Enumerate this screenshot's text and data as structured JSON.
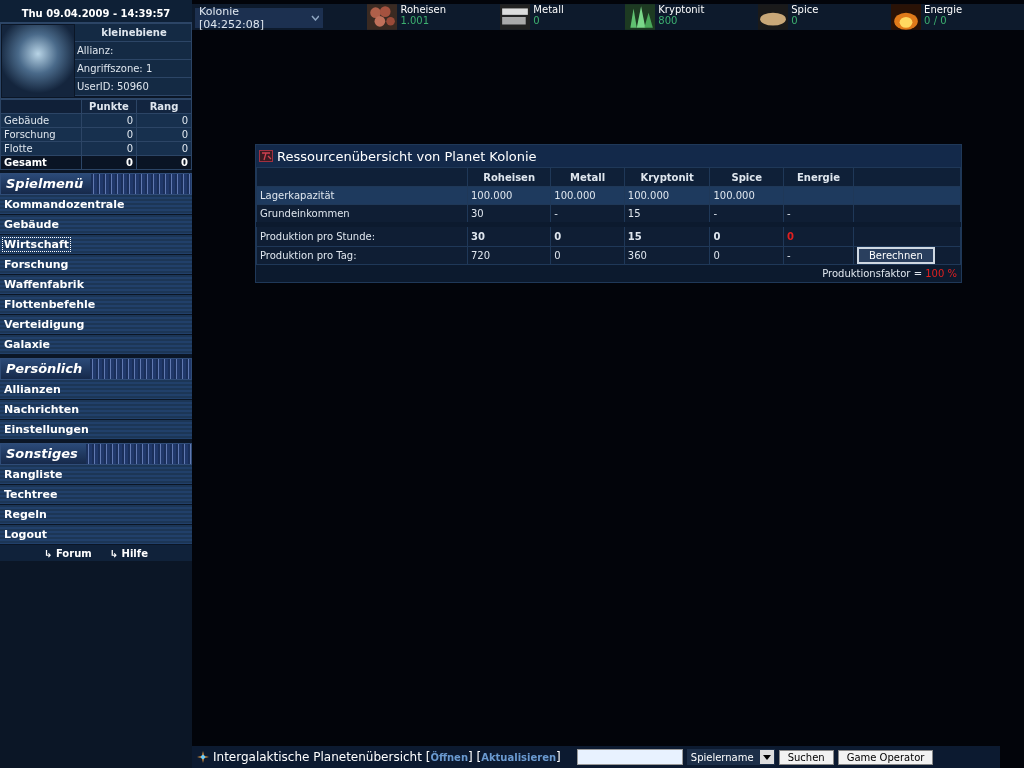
{
  "sidebar": {
    "datetime": "Thu 09.04.2009 - 14:39:57",
    "profile": {
      "username": "kleinebiene",
      "fields": [
        "Allianz:",
        "Angriffszone: 1",
        "UserID: 50960"
      ]
    },
    "stats": {
      "columns": [
        "Punkte",
        "Rang"
      ],
      "rows": [
        {
          "label": "Gebäude",
          "punkte": "0",
          "rang": "0",
          "total": false
        },
        {
          "label": "Forschung",
          "punkte": "0",
          "rang": "0",
          "total": false
        },
        {
          "label": "Flotte",
          "punkte": "0",
          "rang": "0",
          "total": false
        },
        {
          "label": "Gesamt",
          "punkte": "0",
          "rang": "0",
          "total": true
        }
      ]
    },
    "menus": [
      {
        "title": "Spielmenü",
        "items": [
          {
            "label": "Kommandozentrale",
            "selected": false
          },
          {
            "label": "Gebäude",
            "selected": false
          },
          {
            "label": "Wirtschaft",
            "selected": true
          },
          {
            "label": "Forschung",
            "selected": false
          },
          {
            "label": "Waffenfabrik",
            "selected": false
          },
          {
            "label": "Flottenbefehle",
            "selected": false
          },
          {
            "label": "Verteidigung",
            "selected": false
          },
          {
            "label": "Galaxie",
            "selected": false
          }
        ]
      },
      {
        "title": "Persönlich",
        "items": [
          {
            "label": "Allianzen",
            "selected": false
          },
          {
            "label": "Nachrichten",
            "selected": false
          },
          {
            "label": "Einstellungen",
            "selected": false
          }
        ]
      },
      {
        "title": "Sonstiges",
        "items": [
          {
            "label": "Rangliste",
            "selected": false
          },
          {
            "label": "Techtree",
            "selected": false
          },
          {
            "label": "Regeln",
            "selected": false
          },
          {
            "label": "Logout",
            "selected": false
          }
        ]
      }
    ],
    "footer_links": [
      "↳ Forum",
      "↳ Hilfe"
    ]
  },
  "topbar": {
    "planet_select": "Kolonie [04:252:08]",
    "resources": [
      {
        "kind": "ore",
        "name": "Roheisen",
        "amount": "1.001"
      },
      {
        "kind": "metal",
        "name": "Metall",
        "amount": "0"
      },
      {
        "kind": "crystal",
        "name": "Kryptonit",
        "amount": "800"
      },
      {
        "kind": "spice",
        "name": "Spice",
        "amount": "0"
      },
      {
        "kind": "energy",
        "name": "Energie",
        "amount": "0 / 0"
      }
    ]
  },
  "resource_panel": {
    "title": "Ressourcenübersicht von Planet Kolonie",
    "columns": [
      "Roheisen",
      "Metall",
      "Kryptonit",
      "Spice",
      "Energie"
    ],
    "sections": [
      [
        {
          "label": "Lagerkapazität",
          "highlighted": true,
          "bold": false,
          "cells": [
            {
              "text": "100.000",
              "alert": false
            },
            {
              "text": "100.000",
              "alert": false
            },
            {
              "text": "100.000",
              "alert": false
            },
            {
              "text": "100.000",
              "alert": false
            }
          ]
        },
        {
          "label": "Grundeinkommen",
          "highlighted": false,
          "bold": false,
          "cells": [
            {
              "text": "30",
              "alert": false
            },
            {
              "text": "-",
              "alert": false
            },
            {
              "text": "15",
              "alert": false
            },
            {
              "text": "-",
              "alert": false
            },
            {
              "text": "-",
              "alert": false
            }
          ]
        }
      ],
      [
        {
          "label": "Produktion pro Stunde:",
          "highlighted": false,
          "bold": true,
          "cells": [
            {
              "text": "30",
              "alert": false
            },
            {
              "text": "0",
              "alert": false
            },
            {
              "text": "15",
              "alert": false
            },
            {
              "text": "0",
              "alert": false
            },
            {
              "text": "0",
              "alert": true
            }
          ]
        },
        {
          "label": "Produktion pro Tag:",
          "highlighted": false,
          "bold": false,
          "cells": [
            {
              "text": "720",
              "alert": false
            },
            {
              "text": "0",
              "alert": false
            },
            {
              "text": "360",
              "alert": false
            },
            {
              "text": "0",
              "alert": false
            },
            {
              "text": "-",
              "alert": false
            }
          ],
          "button": "Berechnen"
        }
      ]
    ],
    "factor_label": "Produktionsfaktor =",
    "factor_value": "100 %"
  },
  "bottombar": {
    "parts": [
      {
        "kind": "text",
        "text": "Intergalaktische Planetenübersicht ["
      },
      {
        "kind": "link",
        "text": "Öffnen"
      },
      {
        "kind": "text",
        "text": "] ["
      },
      {
        "kind": "link",
        "text": "Aktualisieren"
      },
      {
        "kind": "text",
        "text": "]"
      }
    ],
    "search_select": "Spielername",
    "buttons": [
      "Suchen",
      "Game Operator"
    ]
  }
}
